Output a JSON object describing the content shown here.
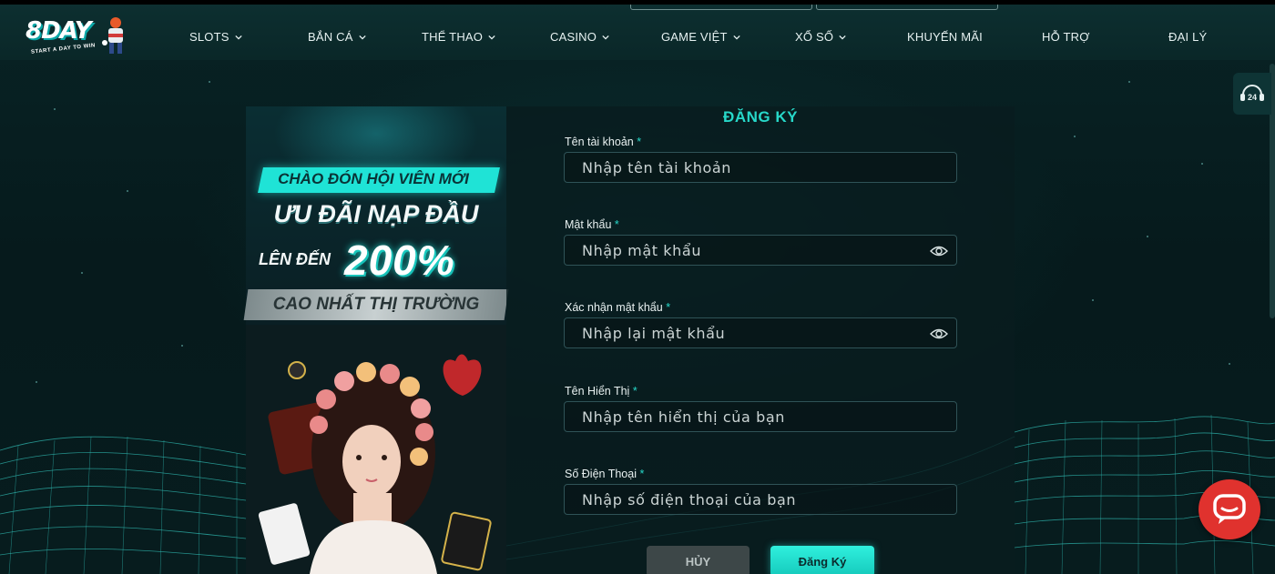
{
  "brand": {
    "logo_text": "8DAY",
    "slogan": "START A DAY TO WIN",
    "accent_color": "#27d8c9"
  },
  "nav": {
    "items": [
      {
        "label": "SLOTS",
        "has_dropdown": true
      },
      {
        "label": "BẮN CÁ",
        "has_dropdown": true
      },
      {
        "label": "THỂ THAO",
        "has_dropdown": true
      },
      {
        "label": "CASINO",
        "has_dropdown": true
      },
      {
        "label": "GAME VIỆT",
        "has_dropdown": true
      },
      {
        "label": "XỔ SỐ",
        "has_dropdown": true
      },
      {
        "label": "KHUYẾN MÃI",
        "has_dropdown": false
      },
      {
        "label": "HỖ TRỢ",
        "has_dropdown": false
      },
      {
        "label": "ĐẠI LÝ",
        "has_dropdown": false
      }
    ]
  },
  "support": {
    "label": "24",
    "icon": "support-24-icon"
  },
  "promo": {
    "line1": "CHÀO ĐÓN HỘI VIÊN MỚI",
    "line2": "ƯU ĐÃI NẠP ĐẦU",
    "line3_prefix": "LÊN ĐẾN",
    "line3_value": "200%",
    "line4": "CAO NHẤT THỊ TRƯỜNG"
  },
  "form": {
    "title": "ĐĂNG KÝ",
    "required_mark": "*",
    "fields": [
      {
        "label": "Tên tài khoản",
        "placeholder": "Nhập tên tài khoản",
        "type": "text",
        "has_eye": false
      },
      {
        "label": "Mật khẩu",
        "placeholder": "Nhập mật khẩu",
        "type": "password",
        "has_eye": true
      },
      {
        "label": "Xác nhận mật khẩu",
        "placeholder": "Nhập lại mật khẩu",
        "type": "password",
        "has_eye": true
      },
      {
        "label": "Tên Hiển Thị",
        "placeholder": "Nhập tên hiển thị của bạn",
        "type": "text",
        "has_eye": false
      },
      {
        "label": "Số Điện Thoại",
        "placeholder": "Nhập số điện thoại của bạn",
        "type": "text",
        "has_eye": false
      }
    ],
    "cancel_label": "HỦY",
    "submit_label": "Đăng Ký"
  },
  "chat": {
    "icon": "chat-bubble-icon",
    "color": "#e0322e"
  }
}
